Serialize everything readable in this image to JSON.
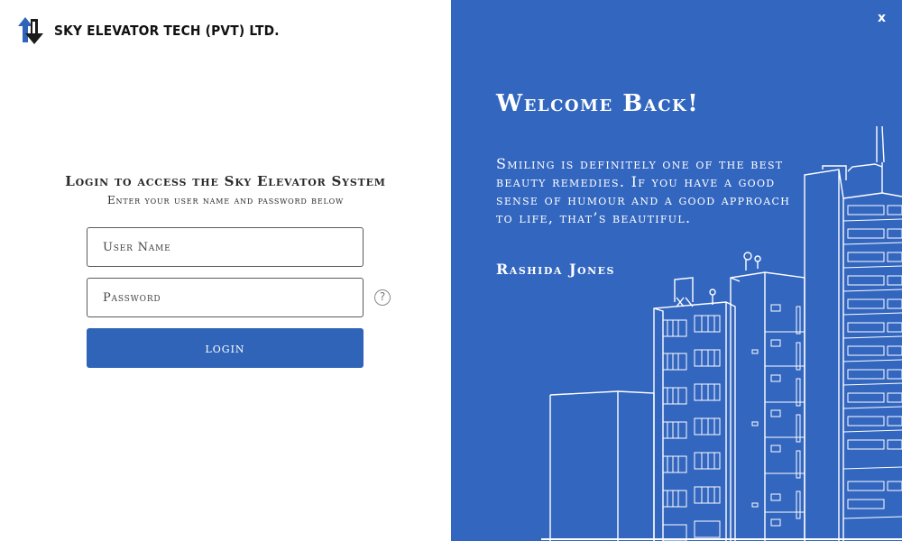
{
  "brand": {
    "name": "SKY ELEVATOR TECH (PVT) LTD.",
    "logo_icon": "elevator-arrows-icon"
  },
  "login": {
    "heading": "Login to access the Sky Elevator System",
    "subheading": "Enter your user name and password below",
    "username_placeholder": "User Name",
    "password_placeholder": "Password",
    "help_label": "?",
    "button_label": "login"
  },
  "welcome": {
    "close_label": "x",
    "title": "Welcome Back!",
    "quote": "Smiling is definitely one of the best beauty remedies. If you have a good sense of humour and a good approach to life, that’s beautiful.",
    "author": "Rashida Jones"
  },
  "colors": {
    "accent": "#2f64b8",
    "panel": "#3366bf",
    "line": "#ffffff"
  }
}
